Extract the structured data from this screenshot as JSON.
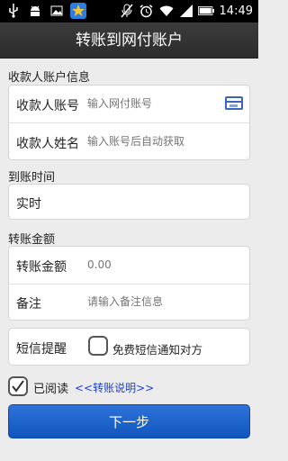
{
  "status_bar": {
    "left_icons": [
      "usb-icon",
      "android-icon",
      "image-icon",
      "star-app-icon"
    ],
    "right_icons": [
      "no-mic-icon",
      "alarm-icon",
      "wifi-icon",
      "signal-icon",
      "battery-icon"
    ],
    "time": "14:49"
  },
  "header": {
    "title": "转账到网付账户"
  },
  "payee": {
    "section_label": "收款人账户信息",
    "account_label": "收款人账号",
    "account_placeholder": "输入网付账号",
    "name_label": "收款人姓名",
    "name_placeholder": "输入账号后自动获取"
  },
  "arrival": {
    "section_label": "到账时间",
    "value": "实时"
  },
  "amount": {
    "section_label": "转账金额",
    "amount_label": "转账金额",
    "amount_placeholder": "0.00",
    "note_label": "备注",
    "note_placeholder": "请输入备注信息"
  },
  "sms": {
    "label": "短信提醒",
    "checkbox_text": "免费短信通知对方",
    "checked": false
  },
  "agreement": {
    "checked": true,
    "read_text": "已阅读",
    "link_text": "<<转账说明>>"
  },
  "next_button": {
    "label": "下一步"
  },
  "colors": {
    "accent": "#1a62c9",
    "link": "#1a3fd6",
    "header_bg": "#333333"
  }
}
